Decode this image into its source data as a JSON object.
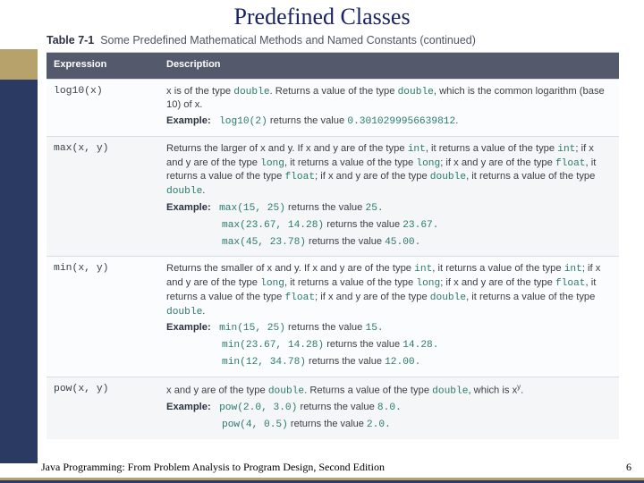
{
  "title": "Predefined Classes",
  "table_caption_prefix": "Table 7-1",
  "table_caption_text": "Some Predefined Mathematical Methods and Named Constants (continued)",
  "headers": {
    "expression": "Expression",
    "description": "Description"
  },
  "rows": {
    "log10": {
      "expr": "log10(x)",
      "desc_a": "x is of the type ",
      "desc_b": ". Returns a value of the type ",
      "desc_c": ", which is the common logarithm (base 10) of x.",
      "kw_double": "double",
      "ex_label": "Example:",
      "ex_code": "log10(2)",
      "ex_mid": " returns the value ",
      "ex_val": "0.3010299956639812"
    },
    "max": {
      "expr": "max(x, y)",
      "desc_a": "Returns the larger of x and y. If x and y are of the type ",
      "desc_b": ", it returns a value of the type ",
      "desc_c": "; if x and y are of the type ",
      "desc_d": ", it returns a value of the type ",
      "desc_e": "; if x and y are of the type ",
      "desc_f": ", it returns a value of the type ",
      "desc_g": "; if x and y are of the type ",
      "desc_h": ", it returns a value of the type ",
      "desc_i": ".",
      "kw_int": "int",
      "kw_long": "long",
      "kw_float": "float",
      "kw_double": "double",
      "ex_label": "Example:",
      "ex1_code": "max(15, 25)",
      "ex1_mid": " returns the value ",
      "ex1_val": "25.",
      "ex2_code": "max(23.67, 14.28)",
      "ex2_mid": " returns the value ",
      "ex2_val": "23.67.",
      "ex3_code": "max(45, 23.78)",
      "ex3_mid": " returns the value ",
      "ex3_val": "45.00."
    },
    "min": {
      "expr": "min(x, y)",
      "desc_a": "Returns the smaller of x and y. If x and y are of the type ",
      "kw_int": "int",
      "kw_long": "long",
      "kw_float": "float",
      "kw_double": "double",
      "ex_label": "Example:",
      "ex1_code": "min(15, 25)",
      "ex1_mid": " returns the value ",
      "ex1_val": "15.",
      "ex2_code": "min(23.67, 14.28)",
      "ex2_mid": " returns the value ",
      "ex2_val": "14.28.",
      "ex3_code": "min(12, 34.78)",
      "ex3_mid": " returns the value ",
      "ex3_val": "12.00."
    },
    "pow": {
      "expr": "pow(x, y)",
      "desc_a": "x and y are of the type ",
      "desc_b": ". Returns a value of the type ",
      "desc_c": ", which is x",
      "desc_d": ".",
      "sup": "y",
      "kw_double": "double",
      "ex_label": "Example:",
      "ex1_code": "pow(2.0, 3.0)",
      "ex1_mid": " returns the value ",
      "ex1_val": "8.0.",
      "ex2_code": "pow(4, 0.5)",
      "ex2_mid": " returns the value ",
      "ex2_val": "2.0."
    }
  },
  "footer": "Java Programming: From Problem Analysis to Program Design, Second Edition",
  "page": "6",
  "chart_data": null
}
